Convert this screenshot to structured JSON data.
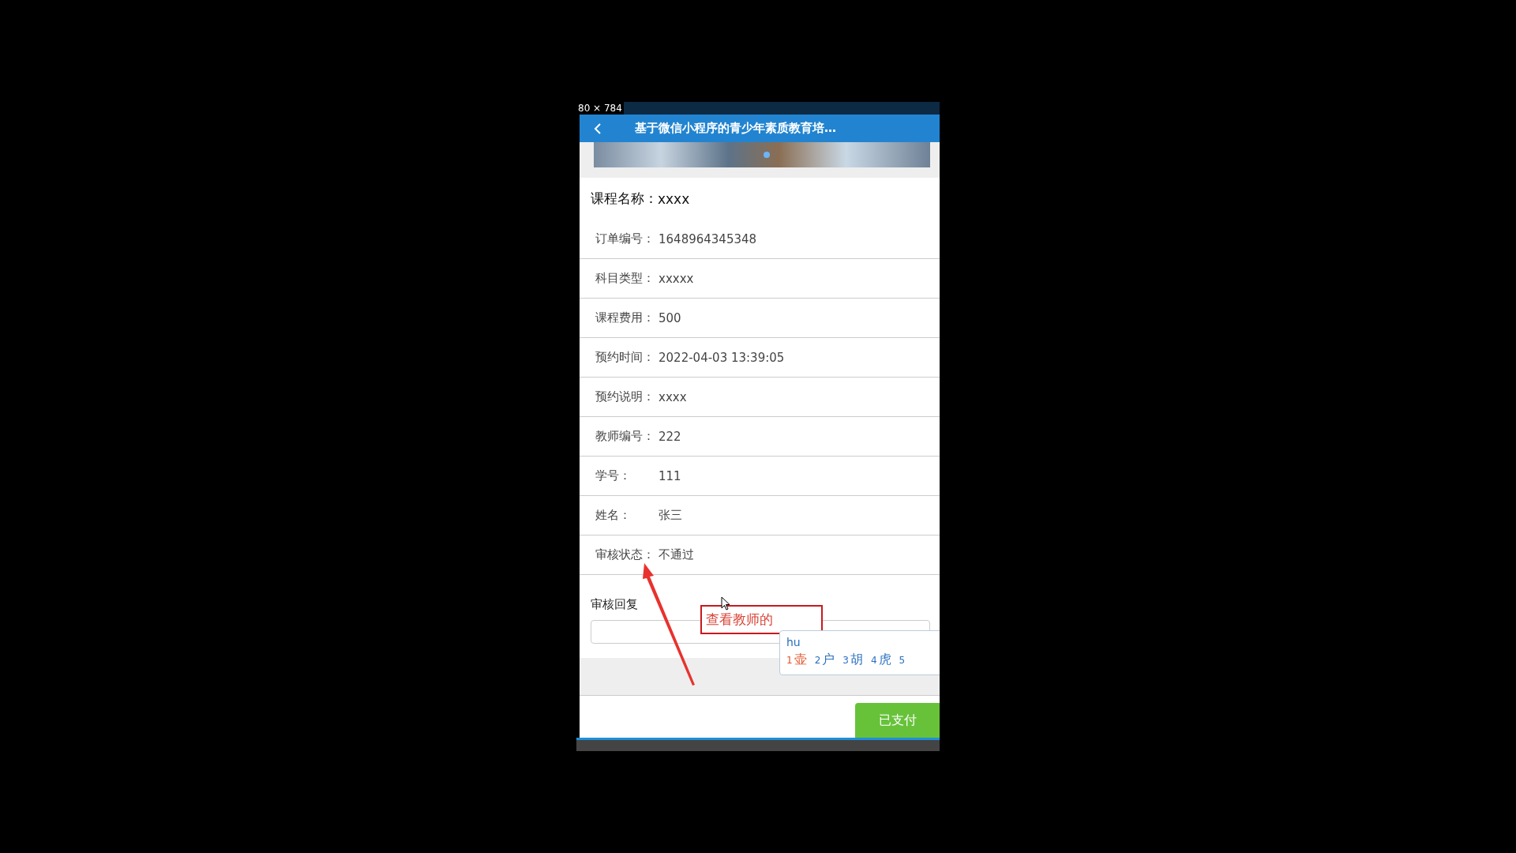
{
  "devtools": {
    "size": "80 × 784"
  },
  "header": {
    "title": "基于微信小程序的青少年素质教育培…"
  },
  "course": {
    "label": "课程名称：",
    "value": "xxxx"
  },
  "fields": [
    {
      "label": "订单编号：",
      "value": "1648964345348"
    },
    {
      "label": "科目类型：",
      "value": "xxxxx"
    },
    {
      "label": "课程费用：",
      "value": "500"
    },
    {
      "label": "预约时间：",
      "value": "2022-04-03 13:39:05"
    },
    {
      "label": "预约说明：",
      "value": "xxxx"
    },
    {
      "label": "教师编号：",
      "value": "222"
    },
    {
      "label": "学号：",
      "value": "111"
    },
    {
      "label": "姓名：",
      "value": "张三"
    },
    {
      "label": "审核状态：",
      "value": "不通过"
    }
  ],
  "reply": {
    "label": "审核回复"
  },
  "button": {
    "label": "已支付"
  },
  "annotation": {
    "text": "查看教师的"
  },
  "ime": {
    "input": "hu",
    "candidates": [
      {
        "index": "1",
        "text": "壶",
        "selected": true
      },
      {
        "index": "2",
        "text": "户",
        "selected": false
      },
      {
        "index": "3",
        "text": "胡",
        "selected": false
      },
      {
        "index": "4",
        "text": "虎",
        "selected": false
      },
      {
        "index": "5",
        "selected": false
      }
    ]
  }
}
